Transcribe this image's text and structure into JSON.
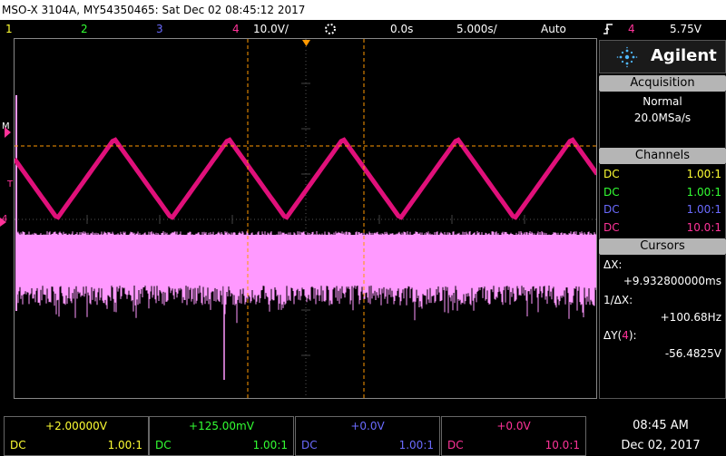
{
  "title_bar": {
    "text": "MSO-X 3104A, MY54350465: Sat Dec 02 08:45:12 2017"
  },
  "status_bar": {
    "ch1": "1",
    "ch2": "2",
    "ch3": "3",
    "ch4": "4",
    "vertical_scale": "10.0V/",
    "trigger_delay": "0.0s",
    "time_scale": "5.000s/",
    "trigger_mode": "Auto",
    "trigger_slope_icon": "rising-edge-icon",
    "trigger_source": "4",
    "trigger_level": "5.75V"
  },
  "colors": {
    "ch1": "#ffff33",
    "ch2": "#33ff33",
    "ch3": "#6b6bff",
    "ch4": "#ff3399",
    "waveform_triangle": "#e0107a",
    "waveform_noise": "#ff99ff",
    "cursor": "#ff9900",
    "panel_header": "#b5b5b5"
  },
  "left_markers": {
    "m": "M",
    "t": "T",
    "ch4": "4"
  },
  "brand": {
    "name": "Agilent",
    "logo_icon": "agilent-spark-icon"
  },
  "acquisition": {
    "header": "Acquisition",
    "mode": "Normal",
    "rate": "20.0MSa/s"
  },
  "channels": {
    "header": "Channels",
    "rows": [
      {
        "coupling": "DC",
        "probe": "1.00:1"
      },
      {
        "coupling": "DC",
        "probe": "1.00:1"
      },
      {
        "coupling": "DC",
        "probe": "1.00:1"
      },
      {
        "coupling": "DC",
        "probe": "10.0:1"
      }
    ]
  },
  "cursors": {
    "header": "Cursors",
    "dx_label": "ΔX:",
    "dx_value": "+9.932800000ms",
    "inv_dx_label": "1/ΔX:",
    "inv_dx_value": "+100.68Hz",
    "dy_label_prefix": "ΔY(",
    "dy_channel": "4",
    "dy_label_suffix": "):",
    "dy_value": "-56.4825V"
  },
  "bottom_channels": [
    {
      "offset": "+2.00000V",
      "coupling": "DC",
      "probe": "1.00:1"
    },
    {
      "offset": "+125.00mV",
      "coupling": "DC",
      "probe": "1.00:1"
    },
    {
      "offset": "+0.0V",
      "coupling": "DC",
      "probe": "1.00:1"
    },
    {
      "offset": "+0.0V",
      "coupling": "DC",
      "probe": "10.0:1"
    }
  ],
  "clock": {
    "time": "08:45 AM",
    "date": "Dec 02, 2017"
  }
}
